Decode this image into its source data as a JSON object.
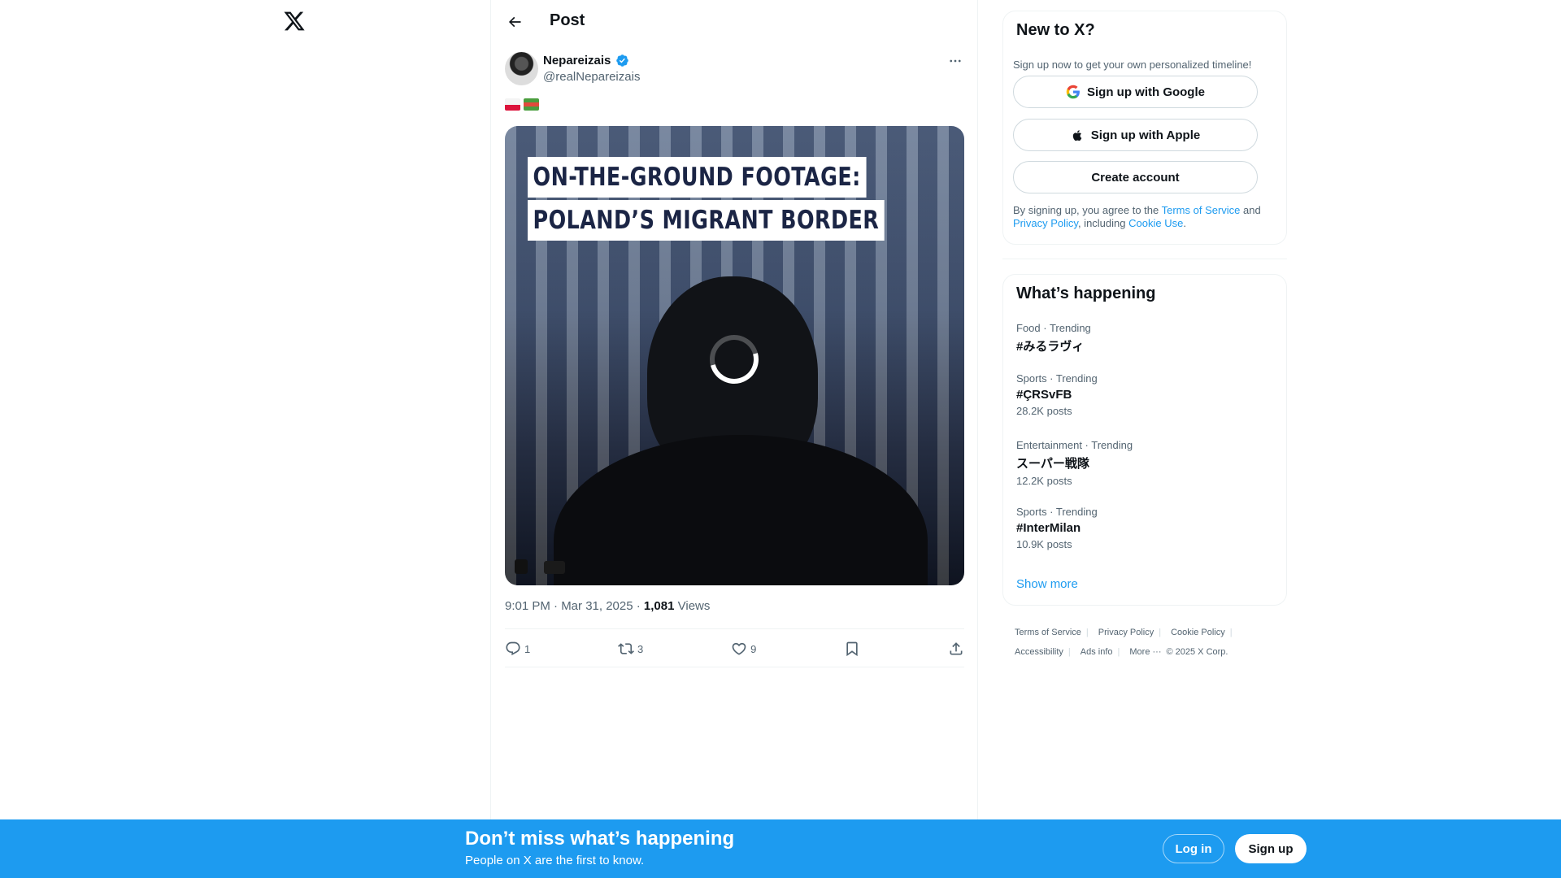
{
  "header": {
    "title": "Post",
    "back_icon": "arrow-left-icon",
    "logo_icon": "x-logo-icon"
  },
  "post": {
    "author_name": "Nepareizais",
    "author_handle": "@realNepareizais",
    "verified": true,
    "flags": [
      "flag-poland-icon",
      "flag-belarus-historical-icon"
    ],
    "media": {
      "banner_line1": "ON-THE-GROUND FOOTAGE:",
      "banner_line2": "POLAND’S MIGRANT BORDER",
      "state": "loading"
    },
    "timestamp": "9:01 PM · Mar 31, 2025 · ",
    "views_count": "1,081",
    "views_label": " Views",
    "stats": {
      "replies": "1",
      "reposts": "3",
      "likes": "9"
    }
  },
  "signup": {
    "title": "New to X?",
    "subtitle": "Sign up now to get your own personalized timeline!",
    "google_label": "Sign up with Google",
    "apple_label": "Sign up with Apple",
    "create_label": "Create account",
    "legal_prefix": "By signing up, you agree to the ",
    "terms_link": "Terms of Service",
    "legal_and": " and ",
    "privacy_link": "Privacy Policy",
    "legal_including": ", including ",
    "cookie_link": "Cookie Use",
    "legal_end": "."
  },
  "trends": {
    "title": "What’s happening",
    "items": [
      {
        "category": "Food · Trending",
        "name": "#みるラヴィ",
        "posts": ""
      },
      {
        "category": "Sports · Trending",
        "name": "#ÇRSvFB",
        "posts": "28.2K posts"
      },
      {
        "category": "Entertainment · Trending",
        "name": "スーパー戦隊",
        "posts": "12.2K posts"
      },
      {
        "category": "Sports · Trending",
        "name": "#InterMilan",
        "posts": "10.9K posts"
      }
    ],
    "show_more": "Show more"
  },
  "footer": {
    "links": [
      "Terms of Service",
      "Privacy Policy",
      "Cookie Policy",
      "Accessibility",
      "Ads info",
      "More ···"
    ],
    "copyright": "© 2025 X Corp."
  },
  "bottom_bar": {
    "title": "Don’t miss what’s happening",
    "subtitle": "People on X are the first to know.",
    "login_label": "Log in",
    "signup_label": "Sign up"
  },
  "colors": {
    "accent": "#1d9bf0",
    "text": "#0f1419",
    "muted": "#536471"
  }
}
